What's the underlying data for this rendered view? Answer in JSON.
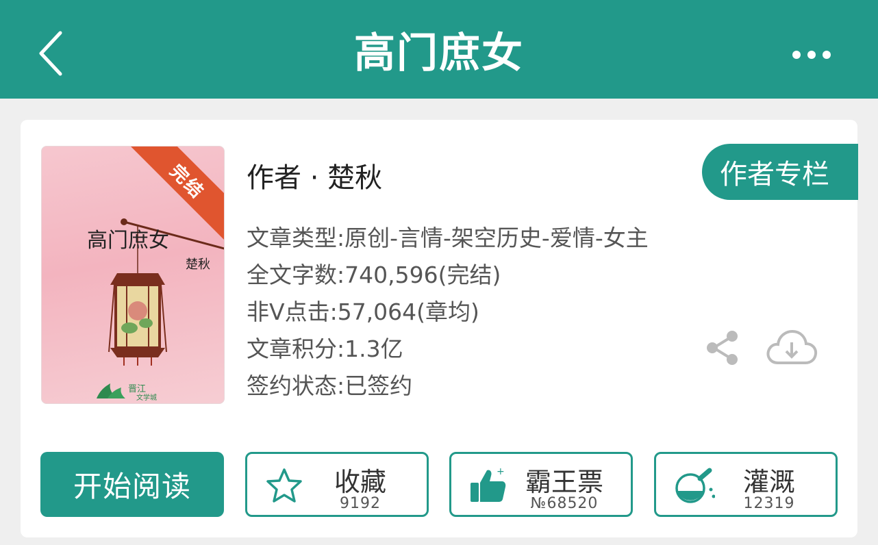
{
  "header": {
    "title": "高门庶女"
  },
  "book": {
    "cover_title": "高门庶女",
    "cover_author": "楚秋",
    "status_ribbon": "完结",
    "cover_logo_text": "晋江文学城",
    "author_line": "作者 · 楚秋",
    "author_column_button": "作者专栏",
    "meta": [
      "文章类型:原创-言情-架空历史-爱情-女主",
      "全文字数:740,596(完结)",
      "非V点击:57,064(章均)",
      "文章积分:1.3亿",
      "签约状态:已签约"
    ]
  },
  "actions": {
    "read_label": "开始阅读",
    "favorite": {
      "label": "收藏",
      "count": "9192",
      "icon": "star-icon"
    },
    "vote": {
      "label": "霸王票",
      "count": "№68520",
      "icon": "thumbs-up-icon"
    },
    "irrigate": {
      "label": "灌溉",
      "count": "12319",
      "icon": "flask-icon"
    }
  },
  "colors": {
    "primary": "#22998a",
    "ribbon": "#e0552f",
    "background": "#efefef"
  }
}
